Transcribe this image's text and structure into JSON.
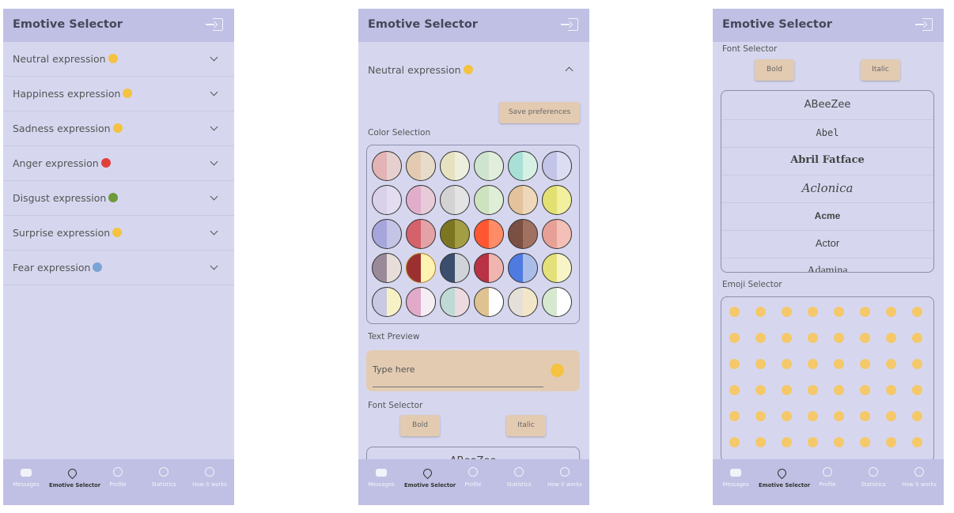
{
  "app": {
    "title": "Emotive Selector"
  },
  "nav": [
    {
      "label": "Messages",
      "icon": "chat-icon",
      "active": false
    },
    {
      "label": "Emotive Selector",
      "icon": "heart-icon",
      "active": true
    },
    {
      "label": "Profile",
      "icon": "profile-icon",
      "active": false
    },
    {
      "label": "Statistics",
      "icon": "statistics-icon",
      "active": false
    },
    {
      "label": "How it works",
      "icon": "help-icon",
      "active": false
    }
  ],
  "expressions": [
    {
      "label": "Neutral expression",
      "emoji": "slightly-smiling-face-icon",
      "color": "#f5c242"
    },
    {
      "label": "Happiness expression",
      "emoji": "grinning-squinting-face-icon",
      "color": "#f5c242"
    },
    {
      "label": "Sadness expression",
      "emoji": "pensive-face-icon",
      "color": "#f5c242"
    },
    {
      "label": "Anger expression",
      "emoji": "angry-face-icon",
      "color": "#e0403a"
    },
    {
      "label": "Disgust expression",
      "emoji": "nauseated-face-icon",
      "color": "#6e9a3a"
    },
    {
      "label": "Surprise expression",
      "emoji": "astonished-face-icon",
      "color": "#f5c242"
    },
    {
      "label": "Fear expression",
      "emoji": "screaming-face-icon",
      "color": "#7aa3d8"
    }
  ],
  "editor": {
    "expression_label": "Neutral expression",
    "save_label": "Save preferences",
    "color_section": "Color Selection",
    "text_preview_section": "Text Preview",
    "text_placeholder": "Type here",
    "font_section": "Font Selector",
    "bold_label": "Bold",
    "italic_label": "Italic",
    "emoji_section": "Emoji Selector",
    "color_pairs": [
      [
        "#e3b3b6",
        "#e6cfcf"
      ],
      [
        "#e3cbb2",
        "#e6dcc9"
      ],
      [
        "#e6e2c0",
        "#eeeedc"
      ],
      [
        "#cfe4cf",
        "#e2eedc"
      ],
      [
        "#a9e0d6",
        "#d7f0e4"
      ],
      [
        "#c3c5e8",
        "#dcdcf3"
      ],
      [
        "#d9d1e9",
        "#e4ddf1"
      ],
      [
        "#e0aecb",
        "#e7cbd8"
      ],
      [
        "#d3d3d3",
        "#e3e3e3"
      ],
      [
        "#cde3c0",
        "#dfeed6"
      ],
      [
        "#e2c39b",
        "#efd8ba"
      ],
      [
        "#e2e070",
        "#f2ef9e"
      ],
      [
        "#a7a6dc",
        "#c4c4e6"
      ],
      [
        "#d4626b",
        "#e3a2a6"
      ],
      [
        "#7c7622",
        "#a39d44"
      ],
      [
        "#ff5731",
        "#ff8c66"
      ],
      [
        "#7a5043",
        "#a07060"
      ],
      [
        "#e7a097",
        "#f3bfb6"
      ],
      [
        "#9a8a99",
        "#e8ded9"
      ],
      [
        "#9c2f2f",
        "#fff3b2"
      ],
      [
        "#3b4e6e",
        "#d0d3d9"
      ],
      [
        "#b83345",
        "#f0b5b0"
      ],
      [
        "#4f7be0",
        "#a9bde8"
      ],
      [
        "#e4e07a",
        "#f7f5c8"
      ],
      [
        "#c9c9e4",
        "#f7f2c6"
      ],
      [
        "#e0aac8",
        "#f4eef4"
      ],
      [
        "#bfd9d5",
        "#edd9e0"
      ],
      [
        "#dfc292",
        "#ffffff"
      ],
      [
        "#e5e0d7",
        "#f3e6c8"
      ],
      [
        "#d7e8d0",
        "#ffffff"
      ]
    ],
    "fonts": [
      "ABeeZee",
      "Abel",
      "Abril Fatface",
      "Aclonica",
      "Acme",
      "Actor",
      "Adamina"
    ],
    "emoji_count": 48
  }
}
